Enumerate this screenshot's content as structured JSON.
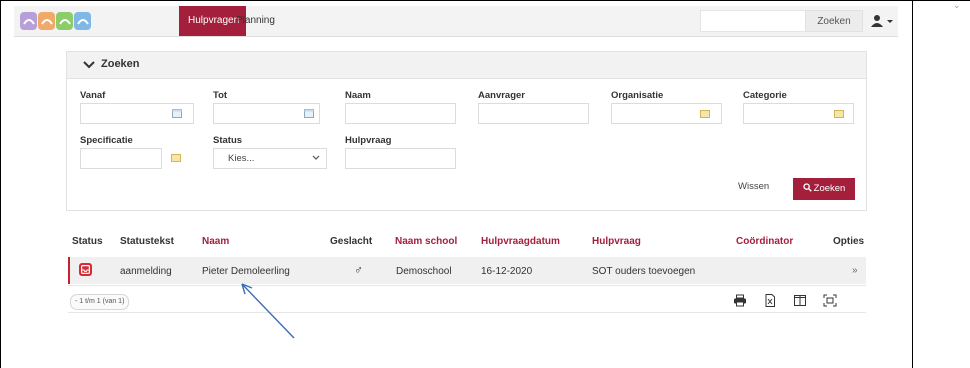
{
  "nav": {
    "tabs": [
      {
        "label": "Hulpvragen",
        "active": true
      },
      {
        "label": "Planning",
        "active": false
      }
    ],
    "search_value": "",
    "search_button": "Zoeken",
    "user_icon": "user-icon"
  },
  "search_panel": {
    "title": "Zoeken",
    "fields": {
      "vanaf": {
        "label": "Vanaf",
        "value": ""
      },
      "tot": {
        "label": "Tot",
        "value": ""
      },
      "naam": {
        "label": "Naam",
        "value": ""
      },
      "aanvrager": {
        "label": "Aanvrager",
        "value": ""
      },
      "organisatie": {
        "label": "Organisatie",
        "value": ""
      },
      "categorie": {
        "label": "Categorie",
        "value": ""
      },
      "specificatie": {
        "label": "Specificatie",
        "value": ""
      },
      "status": {
        "label": "Status",
        "selected": "Kies..."
      },
      "hulpvraag": {
        "label": "Hulpvraag",
        "value": ""
      }
    },
    "clear_label": "Wissen",
    "search_label": "Zoeken"
  },
  "table": {
    "columns": [
      "Status",
      "Statustekst",
      "Naam",
      "Geslacht",
      "Naam school",
      "Hulpvraagdatum",
      "Hulpvraag",
      "Coördinator",
      "Opties"
    ],
    "rows": [
      {
        "statustekst": "aanmelding",
        "naam": "Pieter Demoleerling",
        "geslacht": "♂",
        "naam_school": "Demoschool",
        "hulpvraagdatum": "16-12-2020",
        "hulpvraag": "SOT ouders toevoegen",
        "coordinator": "",
        "opties": "»"
      }
    ],
    "pager": "- 1 t/m 1 (van 1)"
  },
  "colors": {
    "brand": "#a31f3c",
    "status_red": "#d42b34",
    "annotation_arrow": "#3b6cb7"
  }
}
